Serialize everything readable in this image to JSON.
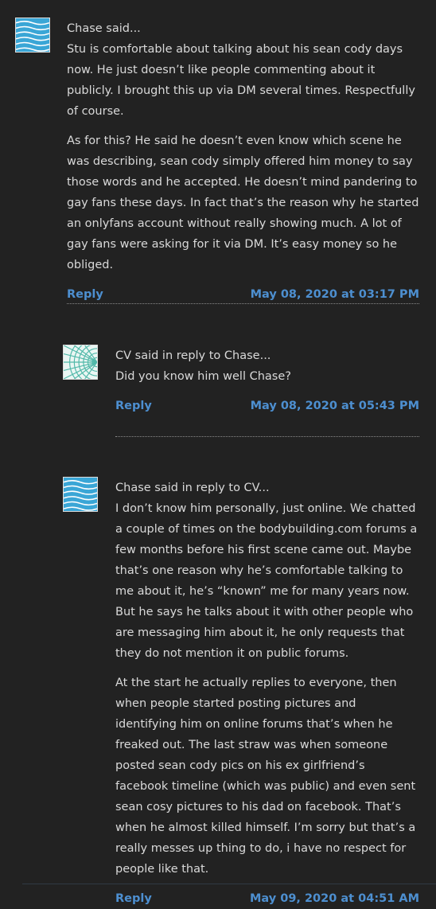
{
  "comments": [
    {
      "author_line": "Chase said...",
      "paragraphs": [
        "Stu is comfortable about talking about his sean cody days now. He just doesn’t like people commenting about it publicly. I brought this up via DM several times. Respectfully of course.",
        "As for this? He said he doesn’t even know which scene he was describing, sean cody simply offered him money to say those words and he accepted. He doesn’t mind pandering to gay fans these days. In fact that’s the reason why he started an onlyfans account without really showing much. A lot of gay fans were asking for it via DM. It’s easy money so he obliged."
      ],
      "reply_label": "Reply",
      "date": "May 08, 2020 at 03:17 PM",
      "avatar_icon": "wave-pattern-avatar-icon"
    },
    {
      "author_line": "CV said in reply to Chase...",
      "paragraphs": [
        "Did you know him well Chase?"
      ],
      "reply_label": "Reply",
      "date": "May 08, 2020 at 05:43 PM",
      "avatar_icon": "fan-pattern-avatar-icon"
    },
    {
      "author_line": "Chase said in reply to CV...",
      "paragraphs": [
        "I don’t know him personally, just online. We chatted a couple of times on the bodybuilding.com forums a few months before his first scene came out. Maybe that’s one reason why he’s comfortable talking to me about it, he’s “known” me for many years now. But he says he talks about it with other people who are messaging him about it, he only requests that they do not mention it on public forums.",
        "At the start he actually replies to everyone, then when people started posting pictures and identifying him on online forums that’s when he freaked out. The last straw was when someone posted sean cody pics on his ex girlfriend’s facebook timeline (which was public) and even sent sean cosy pictures to his dad on facebook. That’s when he almost killed himself. I’m sorry but that’s a really messes up thing to do, i have no respect for people like that."
      ],
      "reply_label": "Reply",
      "date": "May 09, 2020 at 04:51 AM",
      "avatar_icon": "wave-pattern-avatar-icon"
    }
  ],
  "colors": {
    "background": "#222222",
    "text": "#d9d9d9",
    "link": "#4d8fd0",
    "avatar_wave": "#3aa6d6",
    "avatar_fan": "#4fb8a8"
  }
}
